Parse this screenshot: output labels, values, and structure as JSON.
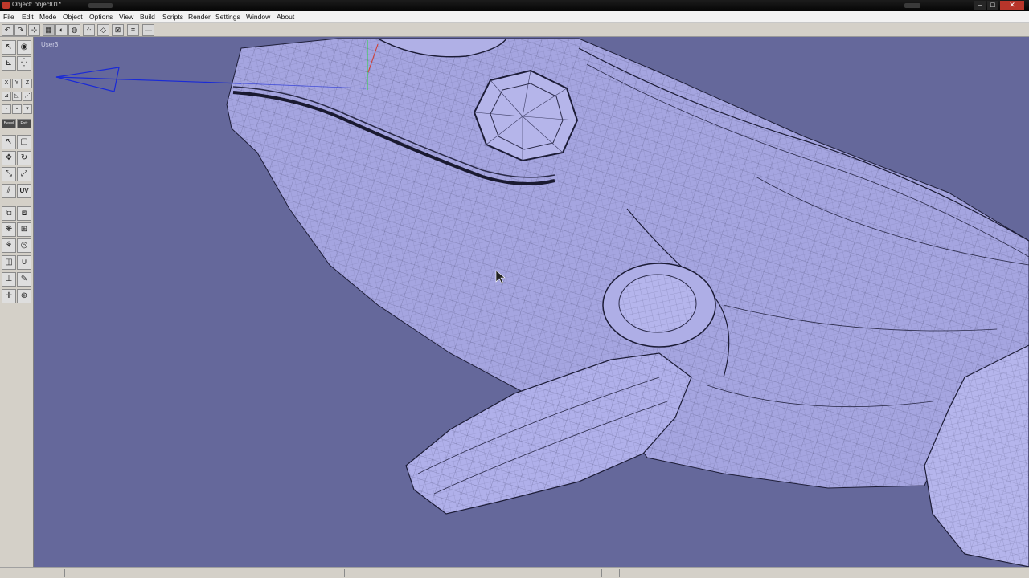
{
  "window": {
    "title": "Object: object01*",
    "buttons": {
      "minimize": "–",
      "maximize": "□",
      "close": "✕"
    }
  },
  "menu": [
    "File",
    "Edit",
    "Mode",
    "Object",
    "Options",
    "View",
    "Build",
    "Scripts",
    "Render",
    "Settings",
    "Window",
    "About"
  ],
  "toolbar": {
    "buttons": [
      {
        "icon": "undo-icon",
        "glyph": "↶"
      },
      {
        "icon": "redo-icon",
        "glyph": "↷"
      },
      {
        "icon": "snap-icon",
        "glyph": "⊹"
      },
      {
        "icon": "wireframe-icon",
        "glyph": "▦"
      },
      {
        "icon": "smooth-shade-icon",
        "glyph": "◐"
      },
      {
        "icon": "sphere-shade-icon",
        "glyph": "◍"
      },
      {
        "icon": "vertex-mode-icon",
        "glyph": "⁘"
      },
      {
        "icon": "edge-mode-icon",
        "glyph": "◇"
      },
      {
        "icon": "face-mode-icon",
        "glyph": "⊠"
      },
      {
        "icon": "grid-icon",
        "glyph": "≡"
      },
      {
        "icon": "blank-icon",
        "glyph": "—"
      }
    ]
  },
  "left_tools": {
    "axis_labels": [
      "X",
      "Y",
      "Z"
    ],
    "bevel_label": "Bevel",
    "extrude_label": "Extr",
    "uv_label": "UV"
  },
  "viewport": {
    "label": "User3",
    "background": "#65689b",
    "mesh_fill": "#a5a5e0",
    "camera_color": "#1a2ad6"
  },
  "colors": {
    "titlebar": "#0a0a0a",
    "close": "#b8352a",
    "panel": "#d4d0c8"
  }
}
